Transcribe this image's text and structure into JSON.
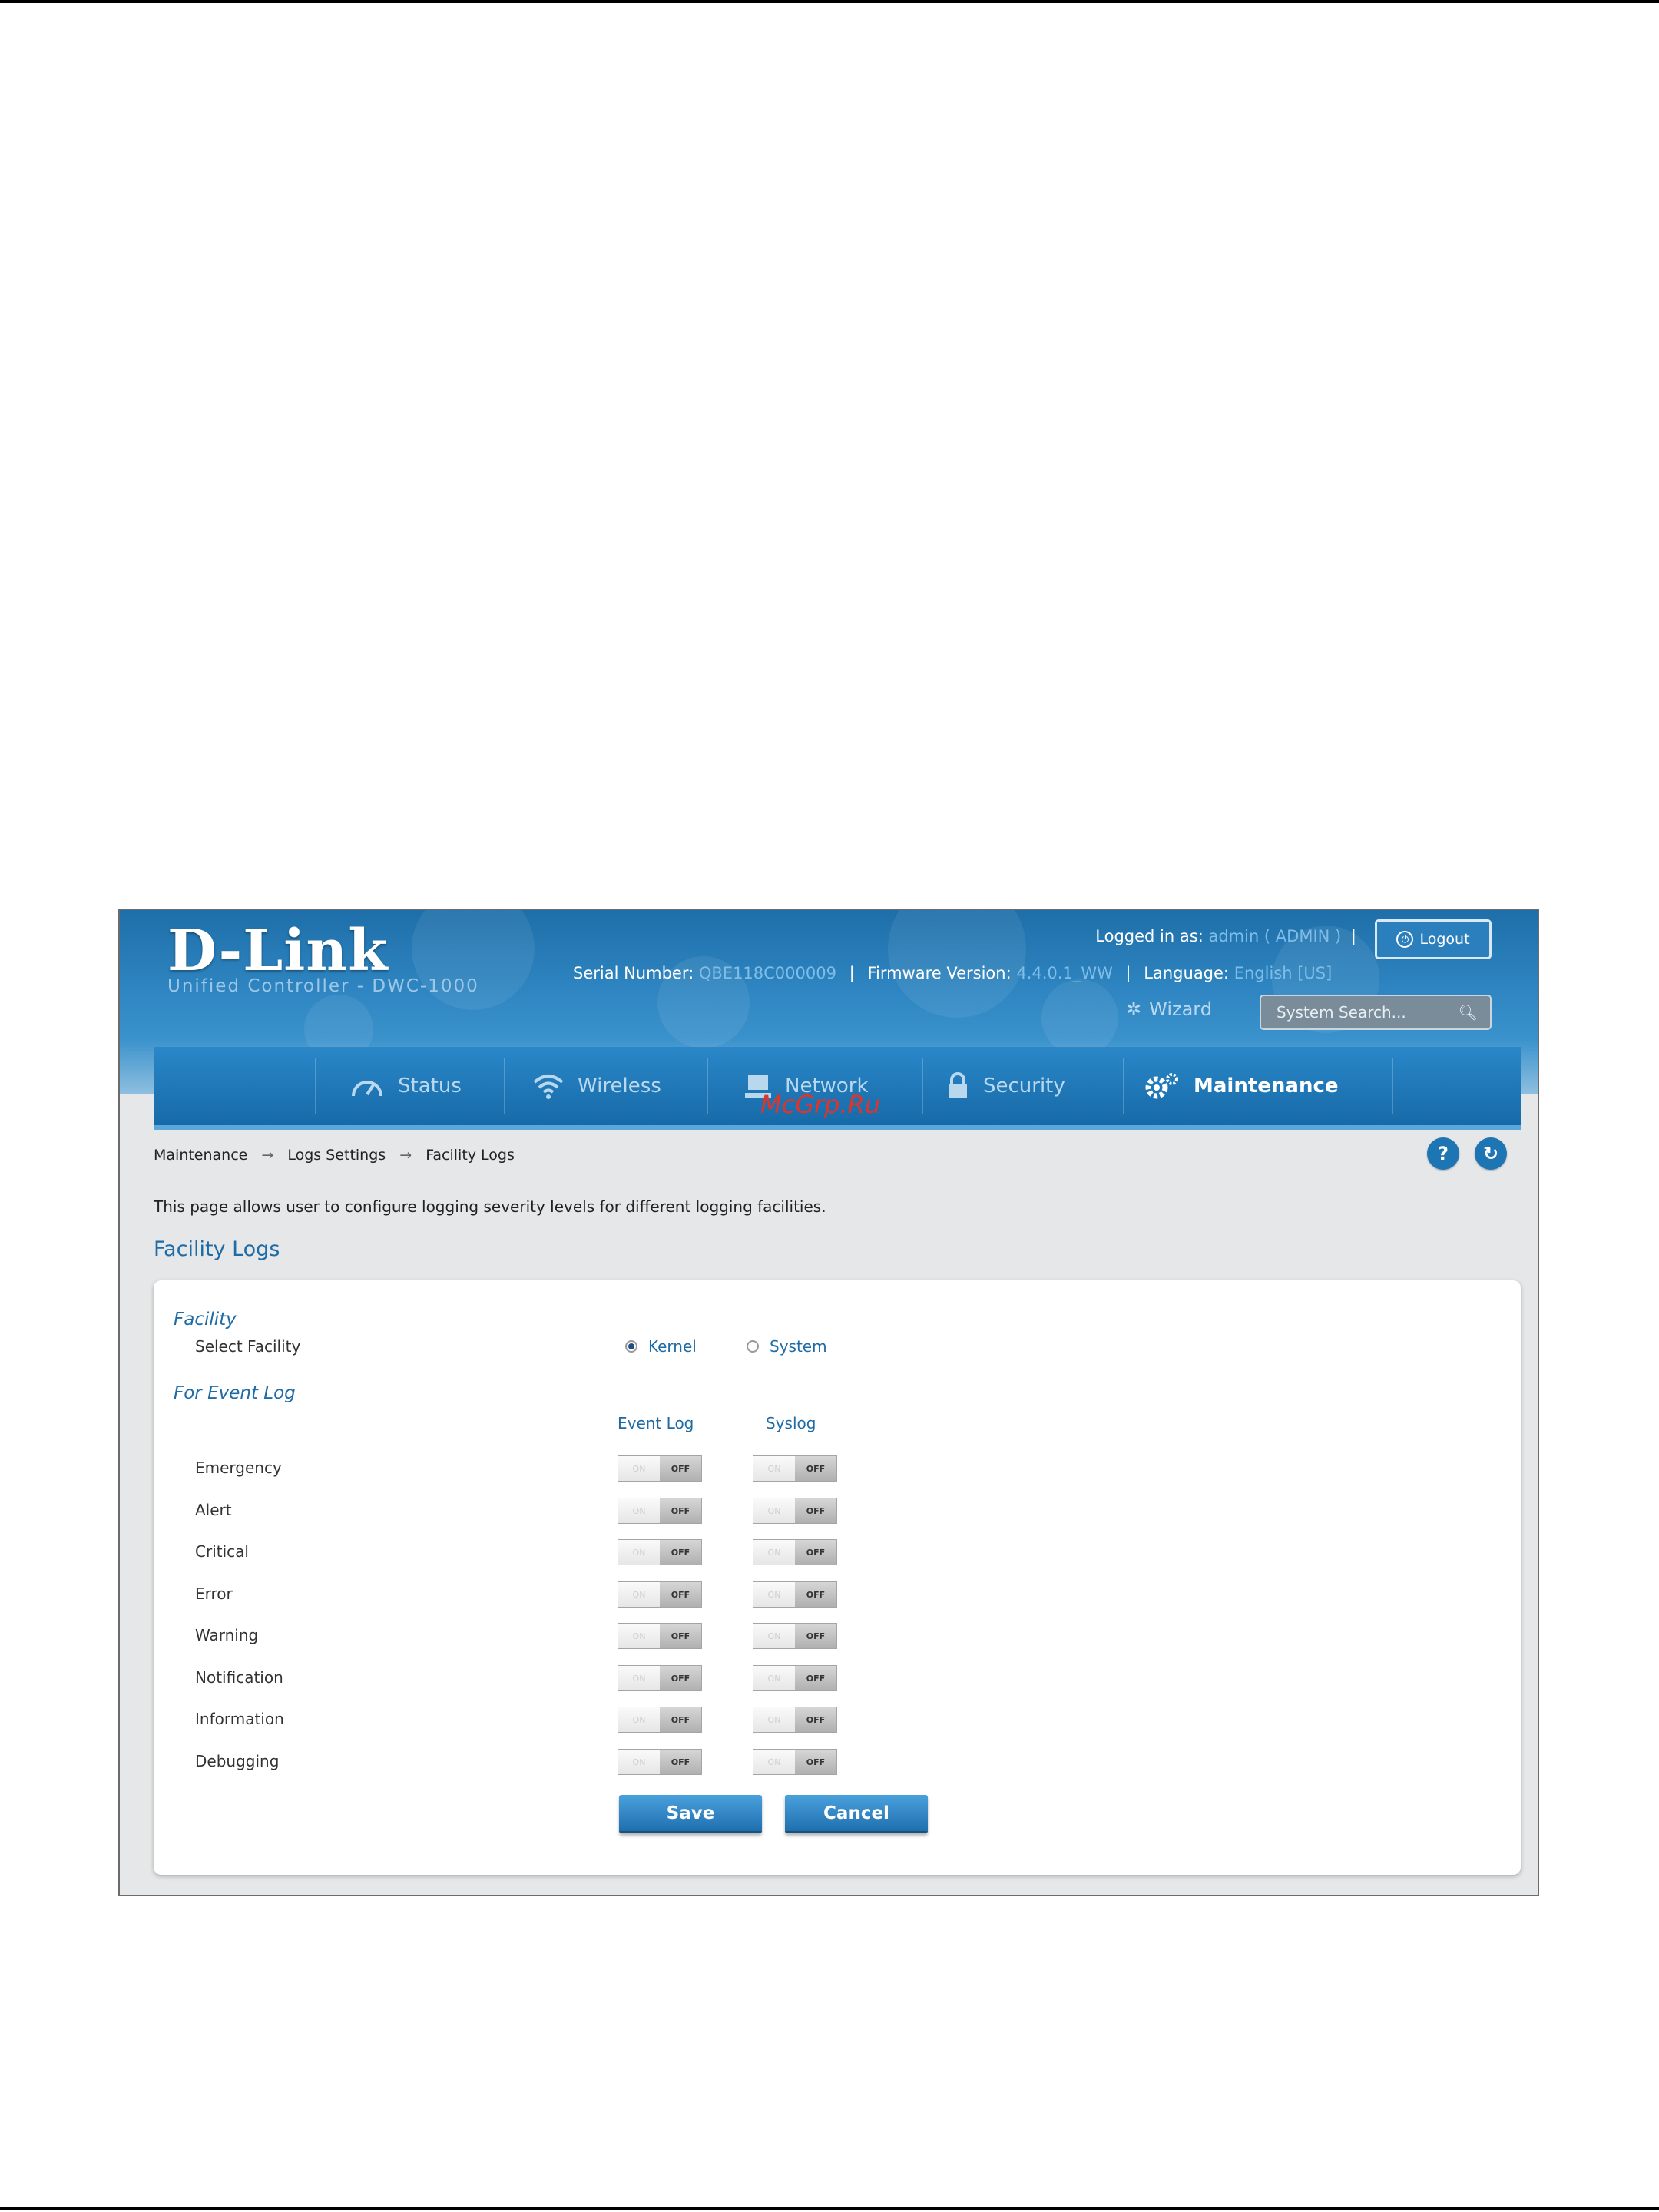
{
  "header": {
    "logo": "D-Link",
    "subtitle": "Unified Controller - DWC-1000",
    "logged_in_label": "Logged in as:",
    "logged_in_user": "admin ( ADMIN )",
    "logout_label": "Logout",
    "serial_label": "Serial Number:",
    "serial_value": "QBE118C000009",
    "firmware_label": "Firmware Version:",
    "firmware_value": "4.4.0.1_WW",
    "language_label": "Language:",
    "language_value": "English [US]",
    "wizard_label": "Wizard",
    "search_placeholder": "System Search..."
  },
  "nav": {
    "items": [
      {
        "label": "Status",
        "icon": "speedometer-icon"
      },
      {
        "label": "Wireless",
        "icon": "wifi-icon"
      },
      {
        "label": "Network",
        "icon": "network-icon"
      },
      {
        "label": "Security",
        "icon": "lock-icon"
      },
      {
        "label": "Maintenance",
        "icon": "gears-icon",
        "active": true
      }
    ]
  },
  "watermark": "McGrp.Ru",
  "breadcrumb": [
    "Maintenance",
    "Logs Settings",
    "Facility Logs"
  ],
  "breadcrumb_separator": "→",
  "description": "This page allows user to configure logging severity levels for different logging facilities.",
  "page_title": "Facility Logs",
  "form": {
    "facility_section": "Facility",
    "select_facility_label": "Select Facility",
    "options": [
      {
        "label": "Kernel",
        "selected": true
      },
      {
        "label": "System",
        "selected": false
      }
    ],
    "event_section": "For Event Log",
    "col_event": "Event Log",
    "col_syslog": "Syslog",
    "toggle_on_text": "ON",
    "toggle_off_text": "OFF",
    "levels": [
      {
        "label": "Emergency",
        "event_log": "OFF",
        "syslog": "OFF"
      },
      {
        "label": "Alert",
        "event_log": "OFF",
        "syslog": "OFF"
      },
      {
        "label": "Critical",
        "event_log": "OFF",
        "syslog": "OFF"
      },
      {
        "label": "Error",
        "event_log": "OFF",
        "syslog": "OFF"
      },
      {
        "label": "Warning",
        "event_log": "OFF",
        "syslog": "OFF"
      },
      {
        "label": "Notification",
        "event_log": "OFF",
        "syslog": "OFF"
      },
      {
        "label": "Information",
        "event_log": "OFF",
        "syslog": "OFF"
      },
      {
        "label": "Debugging",
        "event_log": "OFF",
        "syslog": "OFF"
      }
    ],
    "save_label": "Save",
    "cancel_label": "Cancel"
  },
  "colors": {
    "header_blue": "#2f86c2",
    "title_blue": "#1e6ba6",
    "watermark_red": "#e0342a"
  }
}
